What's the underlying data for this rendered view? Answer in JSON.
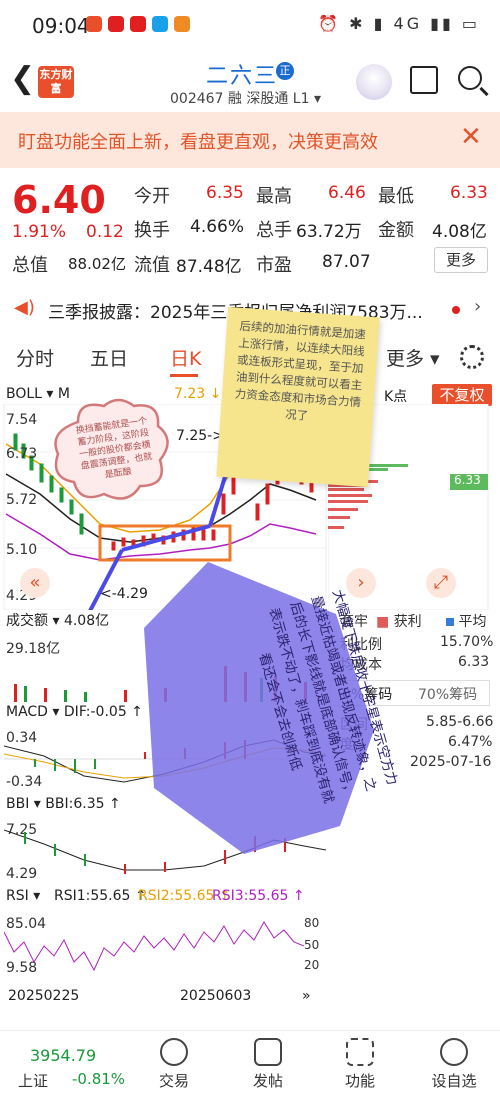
{
  "status": {
    "time": "09:04",
    "right": "4G"
  },
  "header": {
    "logo": "东方财富",
    "name": "二六三",
    "name_badge": "正",
    "code_line": "002467 融 深股通 L1 ▾"
  },
  "banner": {
    "text": "盯盘功能全面上新，看盘更直观，决策更高效",
    "close": "✕"
  },
  "quote": {
    "price": "6.40",
    "pct": "1.91%",
    "chg": "0.12",
    "items": [
      {
        "label": "今开",
        "value": "6.35",
        "red": true
      },
      {
        "label": "最高",
        "value": "6.46",
        "red": true
      },
      {
        "label": "最低",
        "value": "6.33",
        "red": true
      },
      {
        "label": "换手",
        "value": "4.66%",
        "red": false
      },
      {
        "label": "总手",
        "value": "63.72万",
        "red": false
      },
      {
        "label": "金额",
        "value": "4.08亿",
        "red": false
      },
      {
        "label": "总值",
        "value": "88.02亿",
        "red": false
      },
      {
        "label": "流值",
        "value": "87.48亿",
        "red": false
      },
      {
        "label": "市盈",
        "value": "87.07",
        "red": false
      }
    ],
    "more": "更多"
  },
  "news": {
    "text": "三季报披露：2025年三季报归属净利润7583万...",
    "chev": "›"
  },
  "tabs": {
    "t1": "分时",
    "t2": "五日",
    "t3": "日K",
    "t4": "更多 ▾"
  },
  "chart": {
    "boll_label": "BOLL ▾",
    "ma_label": "M",
    "top_value": "7.23 ↓",
    "k_point": "K点",
    "fq": "不复权",
    "y_top": "7.54",
    "y2": "6.73",
    "y3": "5.72",
    "y4": "5.10",
    "y_bottom": "4.29",
    "mark_high": "7.25->",
    "mark_low": "<-4.29",
    "price_tag": "6.33",
    "vol_label": "成交额 ▾",
    "vol_value": "4.08亿",
    "vol_y": "29.18亿",
    "macd_label": "MACD ▾",
    "macd_dif": "DIF:-0.05 ↑",
    "macd_y1": "0.34",
    "macd_y2": "-0.34",
    "bbi_label": "BBI ▾",
    "bbi_value": "BBI:6.35 ↑",
    "bbi_y1": "7.25",
    "bbi_y2": "4.29",
    "rsi_label": "RSI ▾",
    "rsi1": "RSI1:55.65 ↑",
    "rsi2": "RSI2:55.65 ↑",
    "rsi3": "RSI3:55.65 ↑",
    "rsi_y1": "85.04",
    "rsi_y2": "9.58",
    "rsi_r1": "80",
    "rsi_r2": "50",
    "rsi_r3": "20",
    "date1": "20250225",
    "date2": "20250603"
  },
  "chips": {
    "legend_taolao": "套牢",
    "legend_huoli": "获利",
    "legend_pingjun": "平均",
    "profit_label": "利比例",
    "profit_value": "15.70%",
    "cost_label": "均成本",
    "cost_value": "6.33",
    "tab90": "0%筹码",
    "tab70": "70%筹码",
    "range_label": "区间",
    "range_value": "5.85-6.66",
    "conc_label": "度",
    "conc_value": "6.47%",
    "date_value": "2025-07-16"
  },
  "annotations": {
    "sticky": "后续的加油行情就是加速上涨行情，以连续大阳线或连板形式呈现，至于加油到什么程度就可以看主力资金态度和市场合力情况了",
    "cloud": "换挡蓄能就是一个蓄力阶段，这阶段一般的股价都会横盘震荡调整，也就是酝酿",
    "polygon": "大幅度下跌后收十字星表示空方力量接近枯竭或者出现反转迹象，之后的长下影线就是底部确认信号，表示跌不动了，刹车踩到底没有就看还会不会去创新低"
  },
  "bottom": {
    "index_value": "3954.79",
    "index_name": "上证",
    "index_pct": "-0.81%",
    "n1": "交易",
    "n2": "发帖",
    "n3": "功能",
    "n4": "设自选"
  }
}
